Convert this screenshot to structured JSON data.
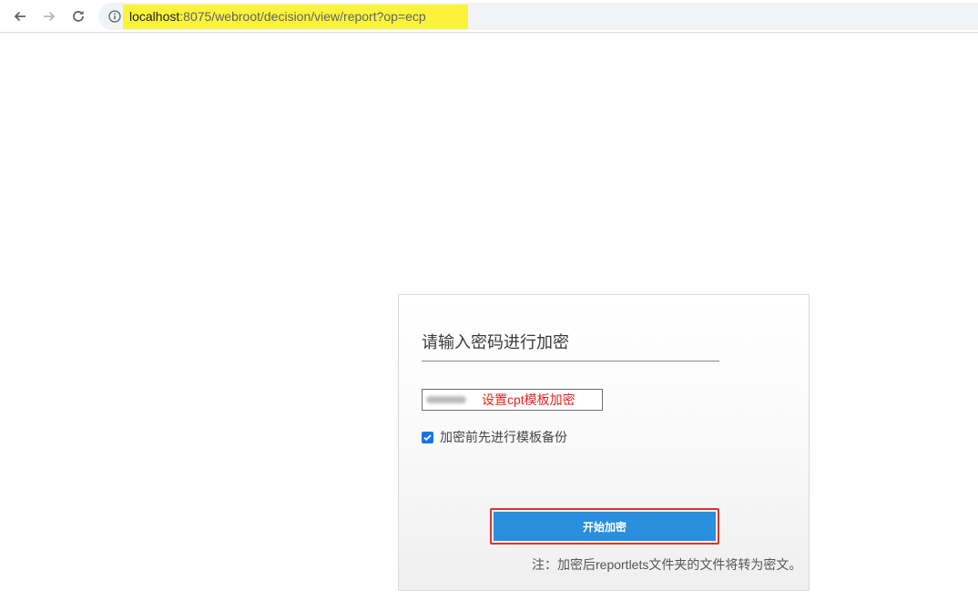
{
  "browser": {
    "url_host": "localhost",
    "url_rest": ":8075/webroot/decision/view/report?op=ecp",
    "highlight_color": "#fbf33a"
  },
  "icons": {
    "back": "arrow-left-icon",
    "forward": "arrow-right-icon",
    "reload": "reload-icon",
    "site_info": "info-icon",
    "checkbox": "checkmark-icon"
  },
  "panel": {
    "title": "请输入密码进行加密",
    "password_annotation": "设置cpt模板加密",
    "backup_label": "加密前先进行模板备份",
    "backup_checked": true,
    "start_button": "开始加密",
    "footnote": "注：加密后reportlets文件夹的文件将转为密文。"
  },
  "colors": {
    "accent": "#2a8fdd",
    "annotation": "#e8231f",
    "checkbox": "#1a73e8"
  }
}
